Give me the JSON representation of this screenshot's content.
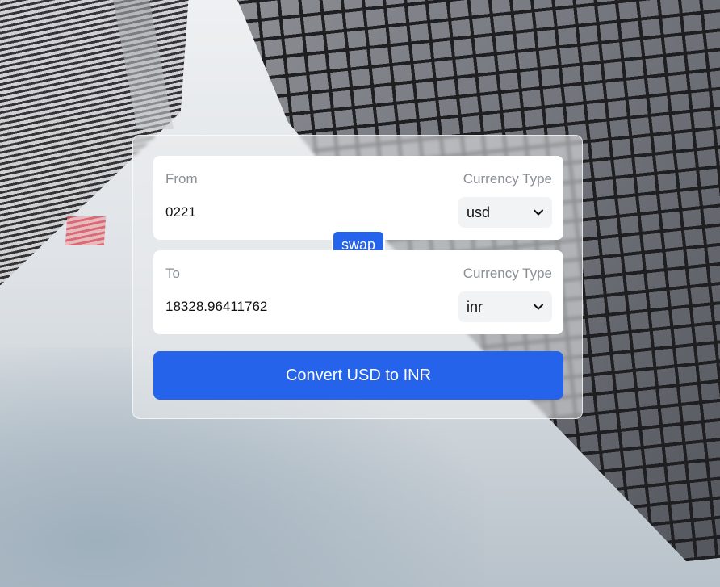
{
  "background": {
    "description_icon": "city-buildings-photo"
  },
  "from": {
    "label": "From",
    "currency_label": "Currency Type",
    "amount": "0221",
    "currency": "usd"
  },
  "swap": {
    "label": "swap"
  },
  "to": {
    "label": "To",
    "currency_label": "Currency Type",
    "amount": "18328.96411762",
    "currency": "inr"
  },
  "convert": {
    "label": "Convert USD to INR"
  },
  "colors": {
    "accent": "#2563eb",
    "card_bg": "#ffffff",
    "label_gray": "#8a8f96"
  }
}
